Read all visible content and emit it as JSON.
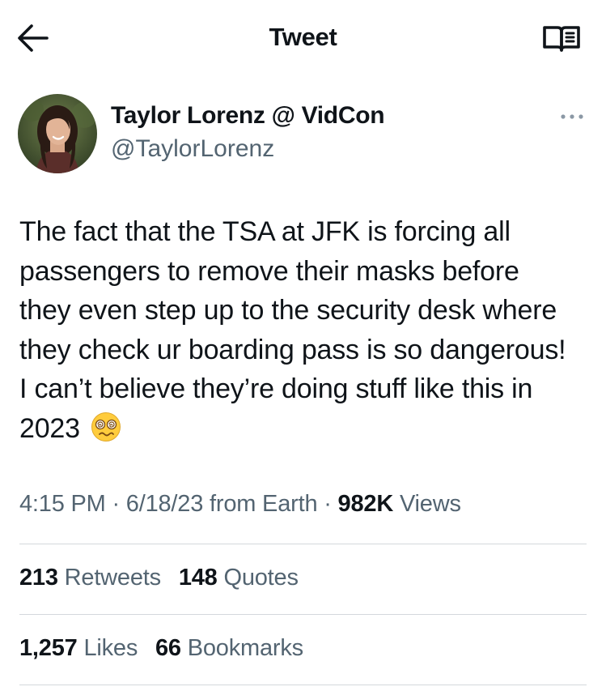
{
  "header": {
    "title": "Tweet",
    "back_icon": "back-arrow-icon",
    "reader_icon": "open-book-icon"
  },
  "author": {
    "display_name": "Taylor Lorenz @ VidCon",
    "handle": "@TaylorLorenz",
    "more_icon": "more-options-icon"
  },
  "tweet": {
    "text": "The fact that the TSA at JFK is forcing all passengers to remove their masks before they even step up to the security desk where they check ur boarding pass is so dangerous! I can’t believe they’re doing stuff like this in 2023",
    "emoji": "face-with-spiral-eyes"
  },
  "meta": {
    "time": "4:15 PM",
    "separator": " · ",
    "date": "6/18/23",
    "source": "from Earth",
    "views_count": "982K",
    "views_label": "Views"
  },
  "stats": {
    "retweets_count": "213",
    "retweets_label": "Retweets",
    "quotes_count": "148",
    "quotes_label": "Quotes",
    "likes_count": "1,257",
    "likes_label": "Likes",
    "bookmarks_count": "66",
    "bookmarks_label": "Bookmarks"
  },
  "colors": {
    "text_primary": "#0f1419",
    "text_secondary": "#536471",
    "divider": "#d4d8dc",
    "emoji_yellow": "#ffcc3d"
  }
}
